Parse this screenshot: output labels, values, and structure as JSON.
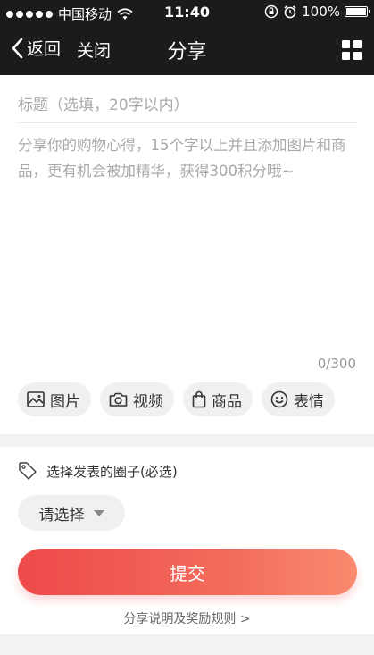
{
  "status_bar": {
    "carrier": "中国移动",
    "time": "11:40",
    "battery": "100%"
  },
  "nav": {
    "back_label": "返回",
    "close_label": "关闭",
    "title": "分享",
    "menu_icon": "grid-icon"
  },
  "editor": {
    "title_placeholder": "标题（选填，20字以内）",
    "content_placeholder": "分享你的购物心得，15个字以上并且添加图片和商品，更有机会被加精华，获得300积分哦~",
    "counter": "0/300",
    "tools": [
      {
        "label": "图片",
        "icon": "image-icon"
      },
      {
        "label": "视频",
        "icon": "camera-icon"
      },
      {
        "label": "商品",
        "icon": "shopping-bag-icon"
      },
      {
        "label": "表情",
        "icon": "smiley-icon"
      }
    ]
  },
  "circle": {
    "label": "选择发表的圈子(必选)",
    "select_value": "请选择",
    "submit_label": "提交",
    "rules_link": "分享说明及奖励规则 >"
  },
  "colors": {
    "nav_background": "#1b1b1b",
    "submit_start": "#ee4a4a",
    "submit_end": "#f98a6e"
  }
}
